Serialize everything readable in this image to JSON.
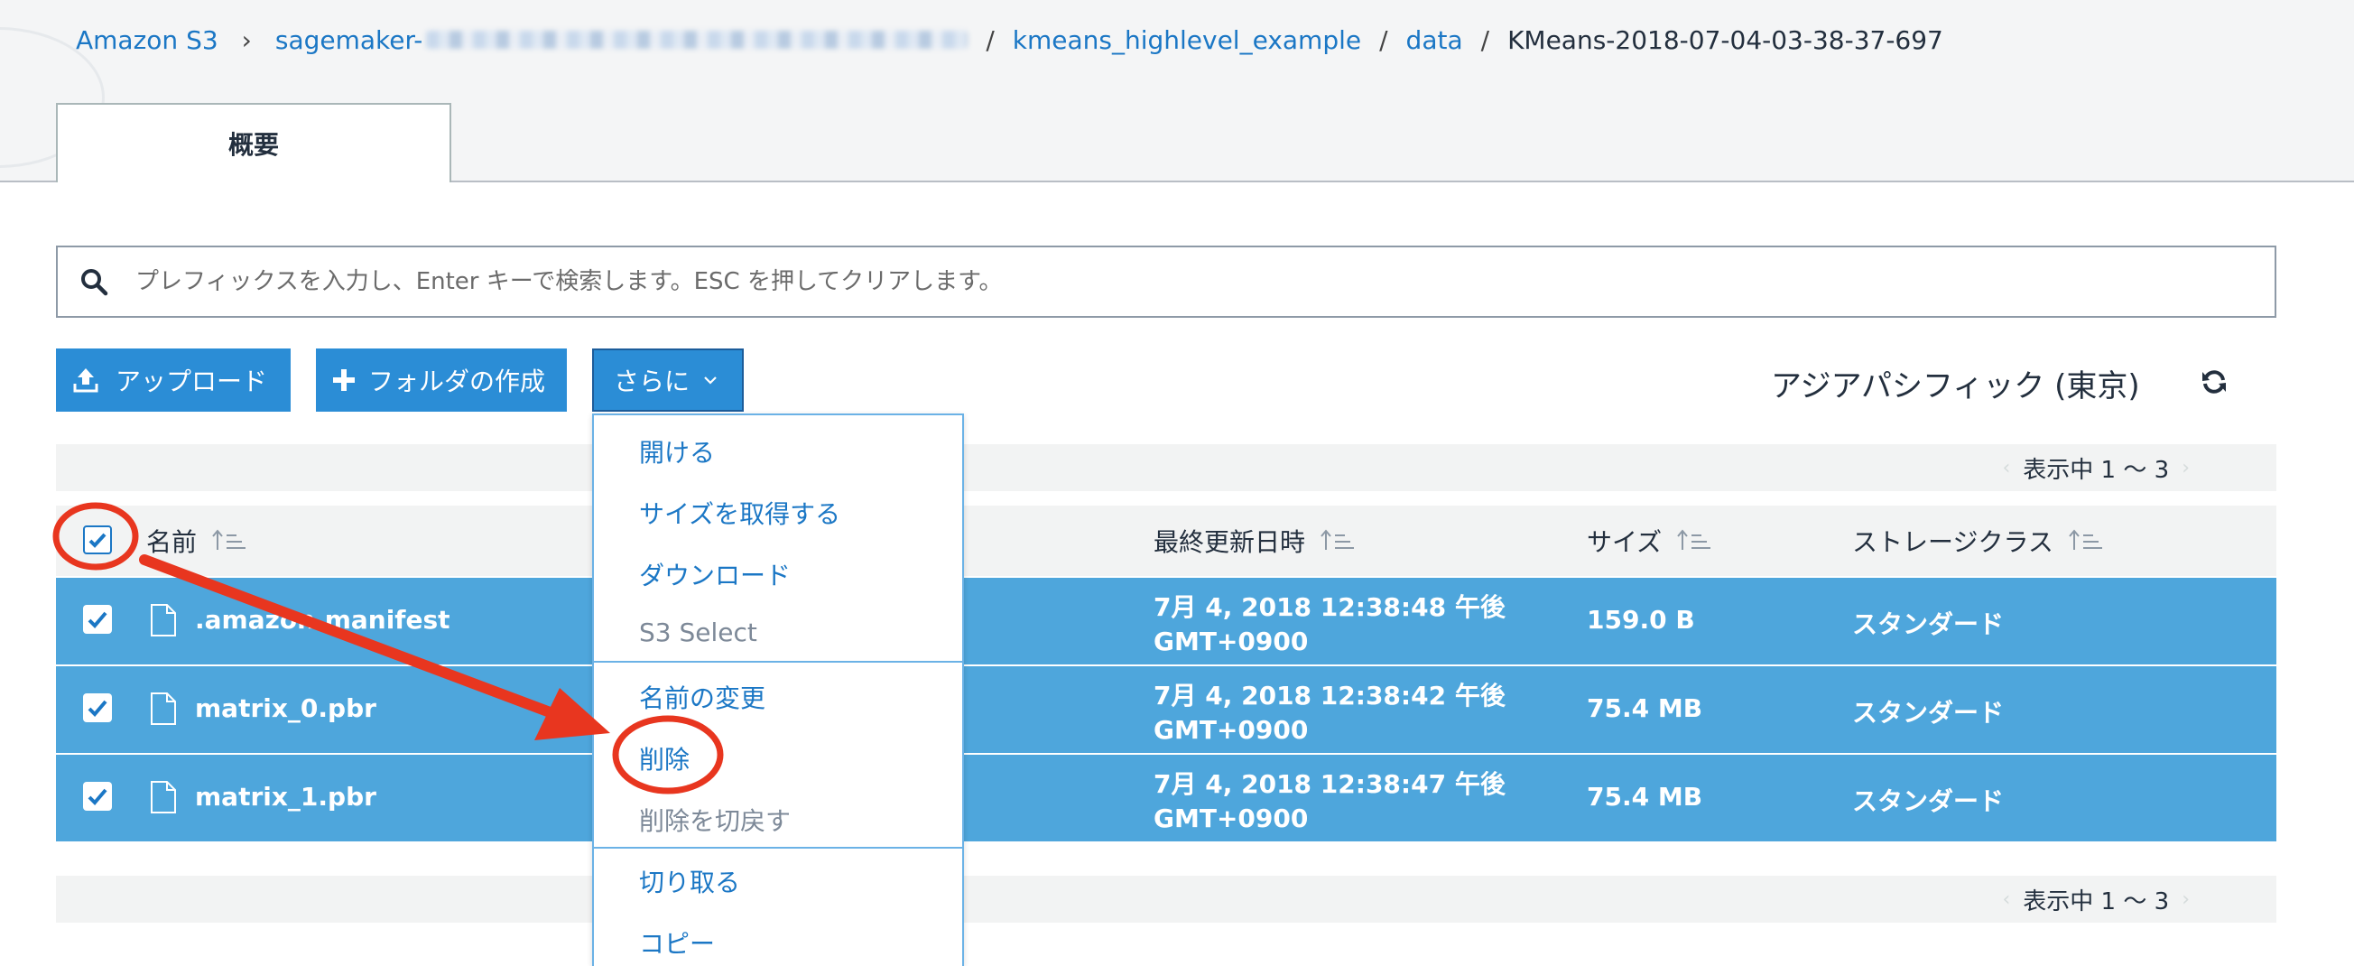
{
  "breadcrumb": {
    "root": "Amazon S3",
    "bucket": "sagemaker-",
    "folder1": "kmeans_highlevel_example",
    "folder2": "data",
    "current": "KMeans-2018-07-04-03-38-37-697",
    "separator_chevron": "›",
    "separator_slash": "/"
  },
  "tabs": [
    {
      "label": "概要",
      "active": true
    }
  ],
  "search": {
    "placeholder": "プレフィックスを入力し、Enter キーで検索します。ESC を押してクリアします。",
    "value": ""
  },
  "toolbar": {
    "upload_label": "アップロード",
    "create_folder_label": "フォルダの作成",
    "more_label": "さらに"
  },
  "region": "アジアパシフィック (東京)",
  "pager": {
    "label": "表示中 1 ～ 3"
  },
  "table": {
    "columns": [
      "名前",
      "最終更新日時",
      "サイズ",
      "ストレージクラス"
    ],
    "rows": [
      {
        "name": ".amazon.manifest",
        "date_line1": "7月 4, 2018 12:38:48 午後",
        "date_line2": "GMT+0900",
        "size": "159.0 B",
        "storage_class": "スタンダード",
        "checked": true
      },
      {
        "name": "matrix_0.pbr",
        "date_line1": "7月 4, 2018 12:38:42 午後",
        "date_line2": "GMT+0900",
        "size": "75.4 MB",
        "storage_class": "スタンダード",
        "checked": true
      },
      {
        "name": "matrix_1.pbr",
        "date_line1": "7月 4, 2018 12:38:47 午後",
        "date_line2": "GMT+0900",
        "size": "75.4 MB",
        "storage_class": "スタンダード",
        "checked": true
      }
    ]
  },
  "dropdown": {
    "items": [
      {
        "label": "開ける",
        "enabled": true
      },
      {
        "label": "サイズを取得する",
        "enabled": true
      },
      {
        "label": "ダウンロード",
        "enabled": true
      },
      {
        "label": "S3 Select",
        "enabled": false
      },
      {
        "label": "名前の変更",
        "enabled": true
      },
      {
        "label": "削除",
        "enabled": true
      },
      {
        "label": "削除を切戻す",
        "enabled": false
      },
      {
        "label": "切り取る",
        "enabled": true
      },
      {
        "label": "コピー",
        "enabled": true
      }
    ]
  },
  "colors": {
    "link": "#1b77c5",
    "button": "#2b8dd6",
    "selected_row": "#4ea6dc",
    "annotation": "#e8361f"
  },
  "icons": [
    "search-icon",
    "upload-icon",
    "plus-icon",
    "chevron-down-icon",
    "refresh-icon",
    "sort-icon",
    "file-icon",
    "checkbox-checked-icon"
  ]
}
